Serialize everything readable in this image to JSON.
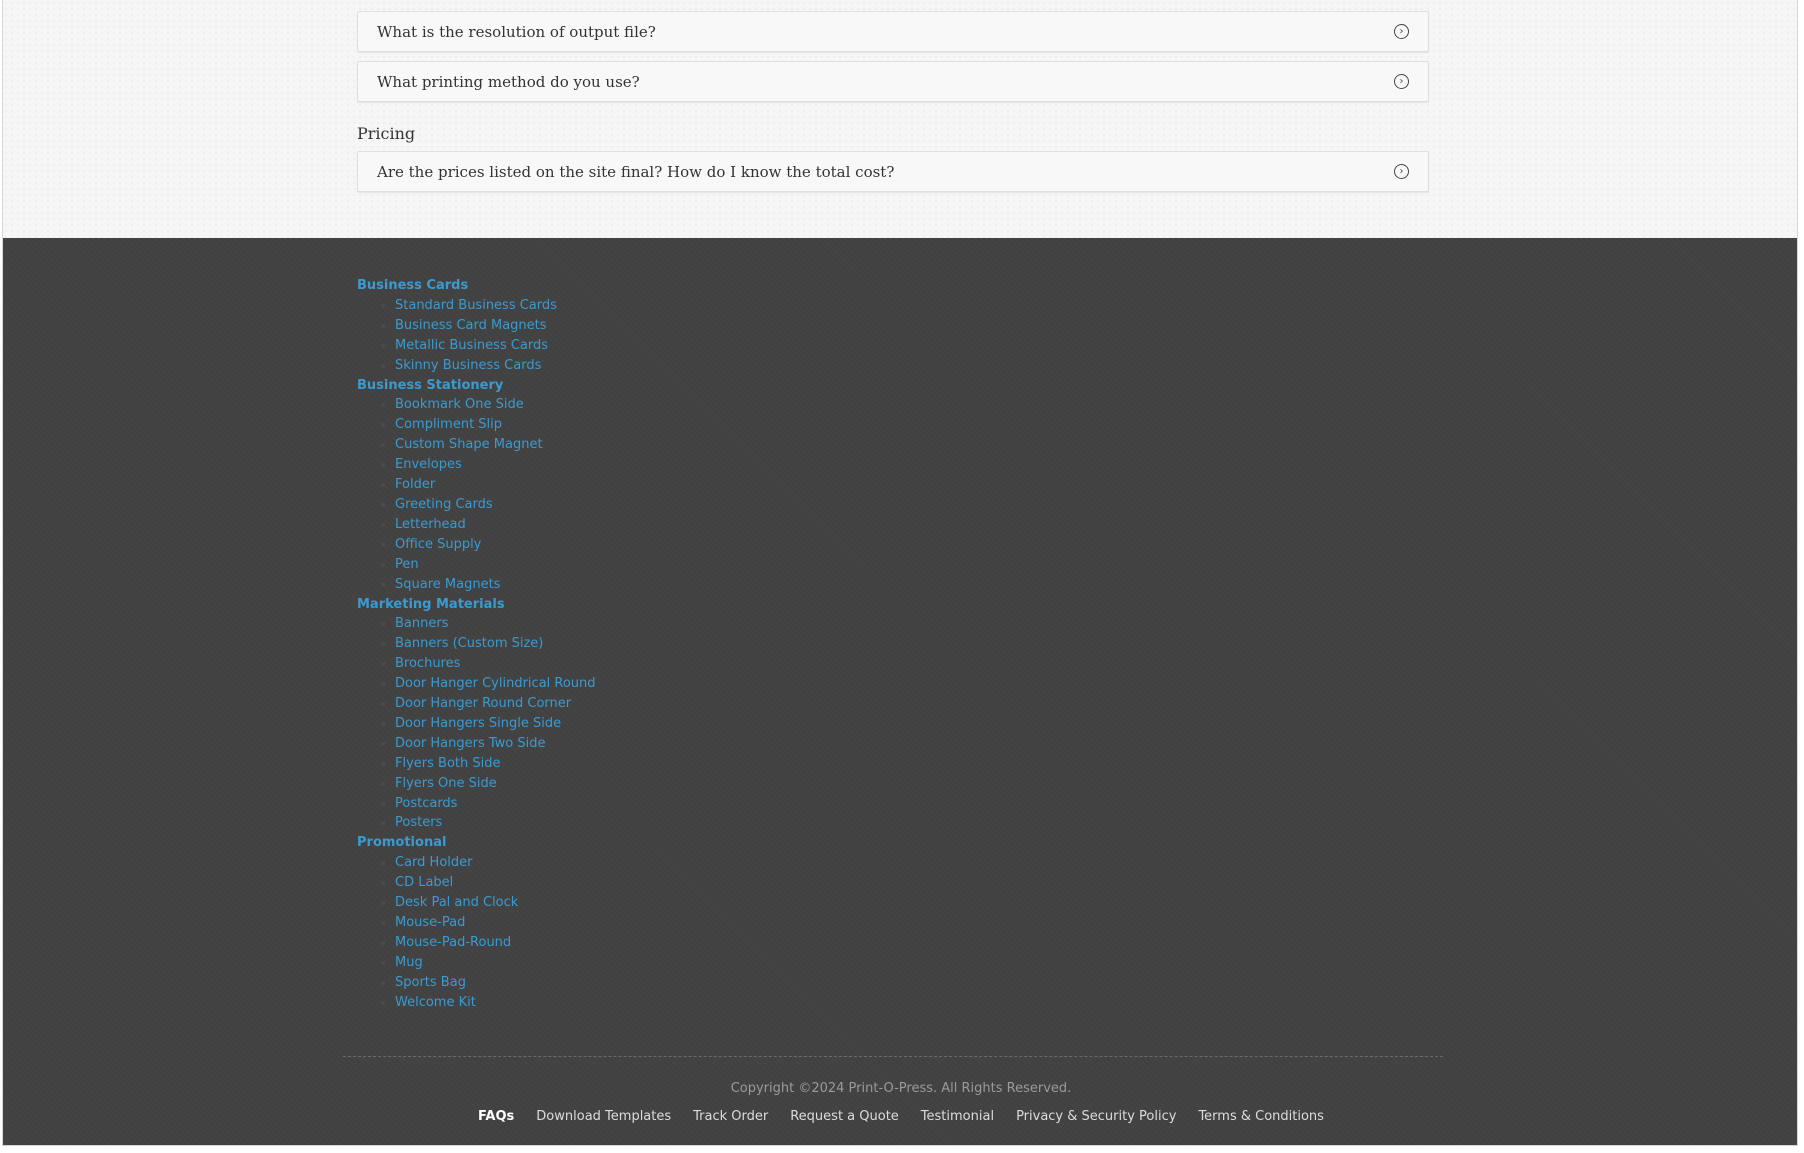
{
  "faq": {
    "items_top": [
      {
        "question": "What is the resolution of output file?"
      },
      {
        "question": "What printing method do you use?"
      }
    ],
    "pricing_heading": "Pricing",
    "items_pricing": [
      {
        "question": "Are the prices listed on the site final? How do I know the total cost?"
      }
    ],
    "expand_icon": "chevron-circle-right-icon"
  },
  "footer": {
    "categories": [
      {
        "title": "Business Cards",
        "items": [
          "Standard Business Cards",
          "Business Card Magnets",
          "Metallic Business Cards",
          "Skinny Business Cards"
        ]
      },
      {
        "title": "Business Stationery",
        "items": [
          "Bookmark One Side",
          "Compliment Slip",
          "Custom Shape Magnet",
          "Envelopes",
          "Folder",
          "Greeting Cards",
          "Letterhead",
          "Office Supply",
          "Pen",
          "Square Magnets"
        ]
      },
      {
        "title": "Marketing Materials",
        "items": [
          "Banners",
          "Banners (Custom Size)",
          "Brochures",
          "Door Hanger Cylindrical Round",
          "Door Hanger Round Corner",
          "Door Hangers Single Side",
          "Door Hangers Two Side",
          "Flyers Both Side",
          "Flyers One Side",
          "Postcards",
          "Posters"
        ]
      },
      {
        "title": "Promotional",
        "items": [
          "Card Holder",
          "CD Label",
          "Desk Pal and Clock",
          "Mouse-Pad",
          "Mouse-Pad-Round",
          "Mug",
          "Sports Bag",
          "Welcome Kit"
        ]
      }
    ],
    "copyright": "Copyright ©2024 Print-O-Press. All Rights Reserved.",
    "links": [
      "FAQs",
      "Download Templates",
      "Track Order",
      "Request a Quote",
      "Testimonial",
      "Privacy & Security Policy",
      "Terms & Conditions"
    ],
    "active_link": "FAQs",
    "link_color": "#3a9bd1",
    "background_color": "#414141"
  }
}
